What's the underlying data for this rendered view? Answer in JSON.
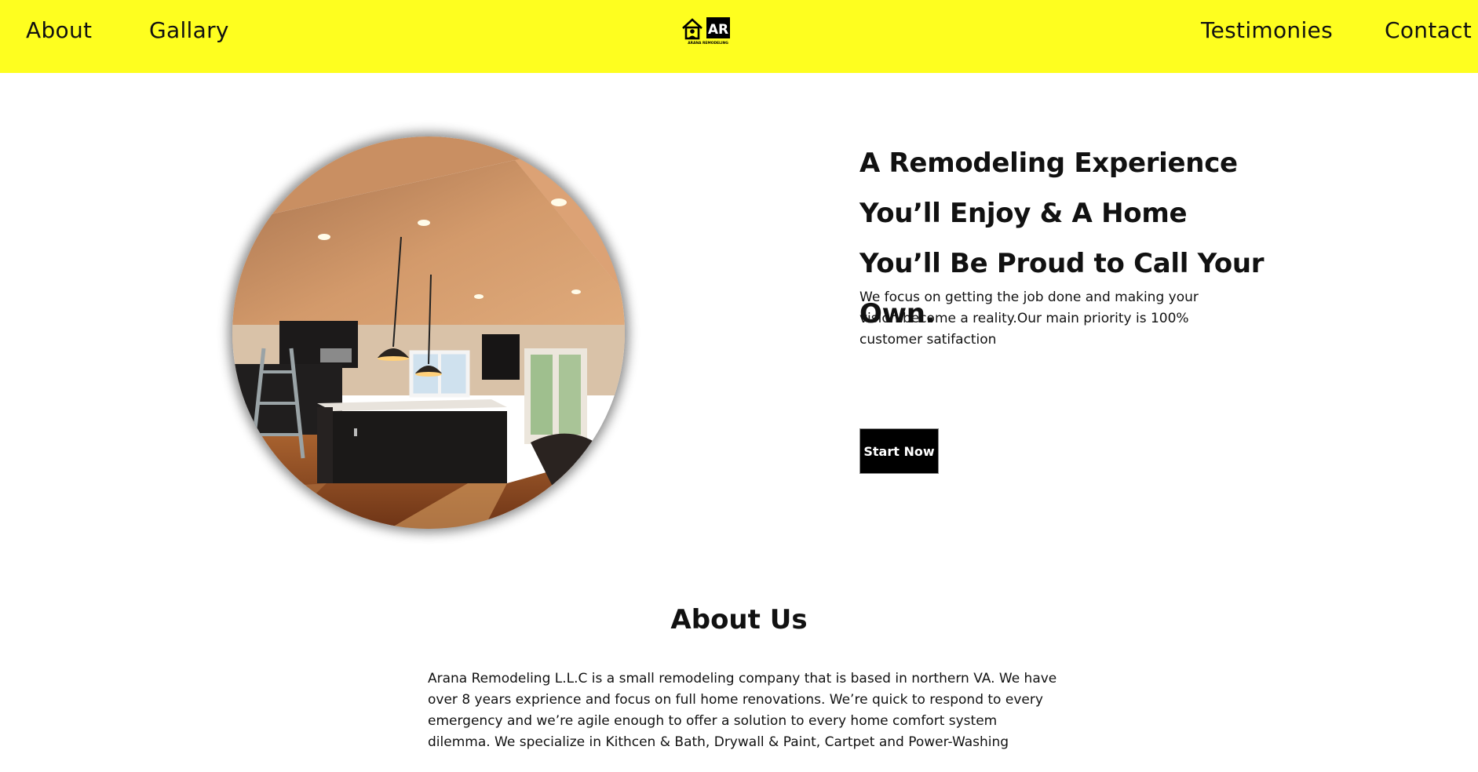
{
  "nav": {
    "about": "About",
    "gallery": "Gallary",
    "testimonies": "Testimonies",
    "contact": "Contact"
  },
  "logo": {
    "initials": "AR",
    "caption": "ARANA REMODELING"
  },
  "hero": {
    "headline": "A Remodeling Experience You’ll Enjoy & A Home You’ll Be Proud to Call Your Own.",
    "tagline": "We focus on getting the job done and making your vision become a reality.Our main priority is 100% customer satifaction",
    "cta": "Start Now"
  },
  "about": {
    "title": "About Us",
    "body": "Arana Remodeling L.L.C is a small remodeling company that is based in northern VA. We have over 8 years exprience and focus on full home renovations. We’re quick to respond to every emergency and we’re agile enough to offer a solution to every home comfort system dilemma. We specialize in Kithcen & Bath, Drywall & Paint, Cartpet and Power-Washing"
  },
  "colors": {
    "navbar": "#fefe1f",
    "button": "#000000",
    "text": "#111111"
  }
}
